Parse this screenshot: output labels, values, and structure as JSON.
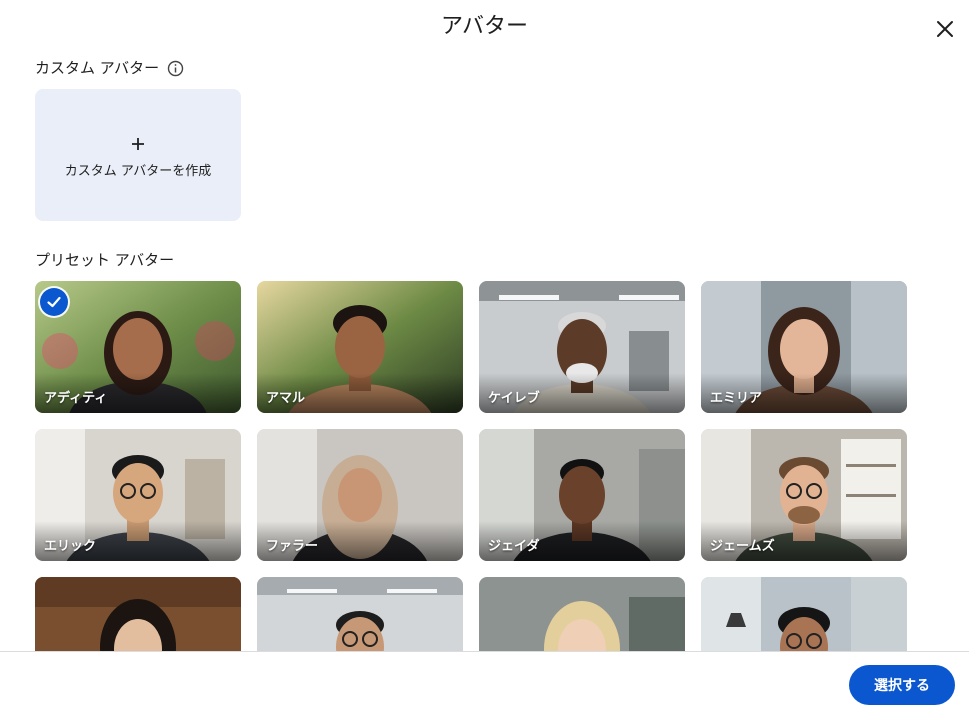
{
  "dialog": {
    "title": "アバター",
    "close_icon": "close-icon"
  },
  "custom_section": {
    "label": "カスタム アバター",
    "info_icon": "info-icon",
    "create_label": "カスタム アバターを作成",
    "create_icon": "plus-icon"
  },
  "preset_section": {
    "label": "プリセット アバター",
    "avatars": [
      {
        "name": "アディティ",
        "selected": true
      },
      {
        "name": "アマル",
        "selected": false
      },
      {
        "name": "ケイレブ",
        "selected": false
      },
      {
        "name": "エミリア",
        "selected": false
      },
      {
        "name": "エリック",
        "selected": false
      },
      {
        "name": "ファラー",
        "selected": false
      },
      {
        "name": "ジェイダ",
        "selected": false
      },
      {
        "name": "ジェームズ",
        "selected": false
      },
      {
        "name": "",
        "selected": false
      },
      {
        "name": "",
        "selected": false
      },
      {
        "name": "",
        "selected": false
      },
      {
        "name": "",
        "selected": false
      }
    ]
  },
  "footer": {
    "select_label": "選択する"
  },
  "colors": {
    "accent": "#0b57d0",
    "custom_card_bg": "#e9eef8"
  }
}
